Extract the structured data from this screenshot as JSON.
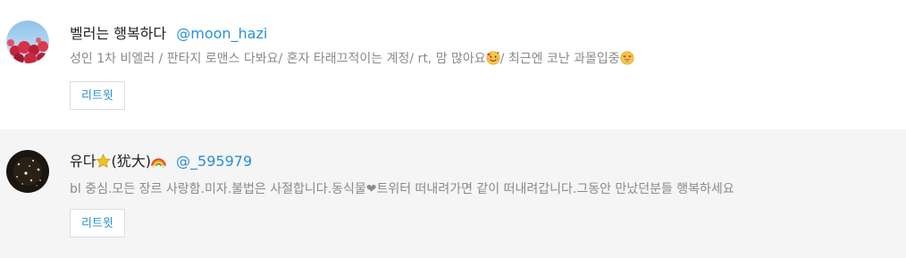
{
  "users": [
    {
      "display_name": "벨러는 행복하다",
      "handle": "@moon_hazi",
      "bio_part1": "성인 1차 비엘러 / 판타지 로맨스 다봐요/ 혼자 타래끄적이는 계정/ rt, 맘 많아요",
      "bio_part2": "/ 최근엔 코난 과몰입중",
      "retweet_label": "리트윗",
      "avatar_icon": "red-roses-sky-avatar",
      "emoji_1": "smiling-face-hearts-icon",
      "emoji_2": "heart-eyes-face-icon"
    },
    {
      "display_name_part1": "유다",
      "display_name_part2": "(犹大)",
      "handle": "@_595979",
      "bio": "bl 중심.모든 장르 사랑함.미자.불법은 사절합니다.동식물❤트위터 떠내려가면 같이 떠내려갑니다.그동안 만났던분들 행복하세요",
      "retweet_label": "리트윗",
      "avatar_icon": "dark-sparkle-avatar",
      "emoji_1": "star-icon",
      "emoji_2": "rainbow-icon"
    }
  ],
  "colors": {
    "link": "#2b8fd6",
    "row_alt_bg": "#f5f5f5",
    "bio_text": "#8a8a8a"
  }
}
